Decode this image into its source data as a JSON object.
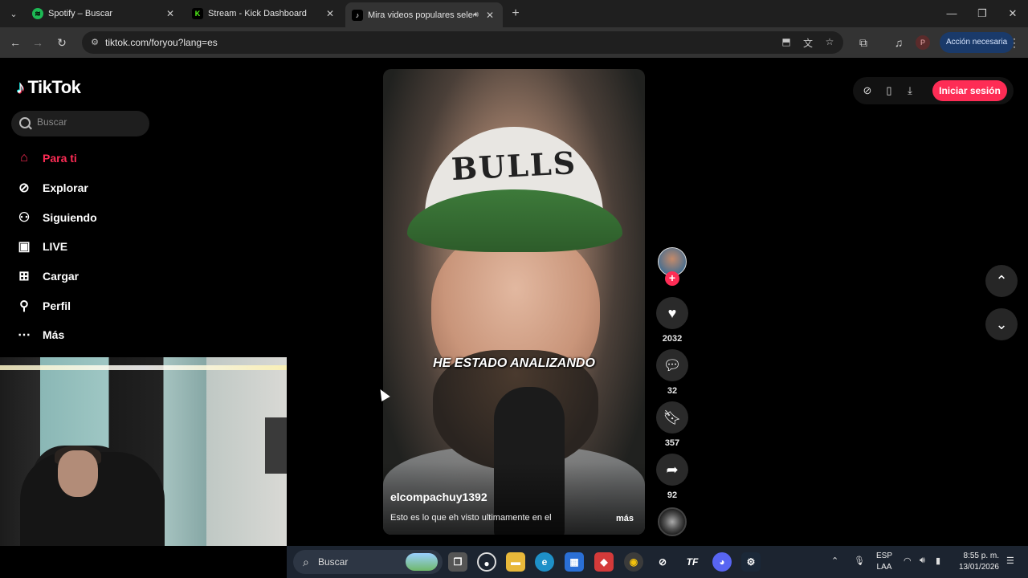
{
  "browser": {
    "tabs": [
      {
        "title": "Spotify – Buscar",
        "favicon": "spotify-icon",
        "color": "#1db954",
        "active": false
      },
      {
        "title": "Stream - Kick Dashboard",
        "favicon": "kick-icon",
        "color": "#53fc18",
        "active": false
      },
      {
        "title": "Mira videos populares selec",
        "favicon": "tiktok-icon",
        "color": "#ffffff",
        "active": true
      }
    ],
    "url": "tiktok.com/foryou?lang=es",
    "profile_initial": "P",
    "action_label": "Acción necesaria"
  },
  "tiktok": {
    "brand": "TikTok",
    "search_placeholder": "Buscar",
    "nav": [
      {
        "label": "Para ti",
        "icon": "home-icon",
        "active": true
      },
      {
        "label": "Explorar",
        "icon": "compass-icon",
        "active": false
      },
      {
        "label": "Siguiendo",
        "icon": "following-icon",
        "active": false
      },
      {
        "label": "LIVE",
        "icon": "live-icon",
        "active": false
      },
      {
        "label": "Cargar",
        "icon": "upload-icon",
        "active": false
      },
      {
        "label": "Perfil",
        "icon": "profile-icon",
        "active": false
      },
      {
        "label": "Más",
        "icon": "more-icon",
        "active": false
      }
    ],
    "login_label": "Iniciar sesión",
    "accent_color": "#fe2c55"
  },
  "video": {
    "cap_text": "BULLS",
    "subtitle": "HE ESTADO ANALIZANDO",
    "author": "elcompachuy1392",
    "description": "Esto es lo que eh visto ultimamente en el",
    "more_label": "más",
    "likes": "2032",
    "comments": "32",
    "saves": "357",
    "shares": "92"
  },
  "taskbar": {
    "search_label": "Buscar",
    "lang_top": "ESP",
    "lang_bottom": "LAA",
    "time": "8:55 p. m.",
    "date": "13/01/2026"
  }
}
